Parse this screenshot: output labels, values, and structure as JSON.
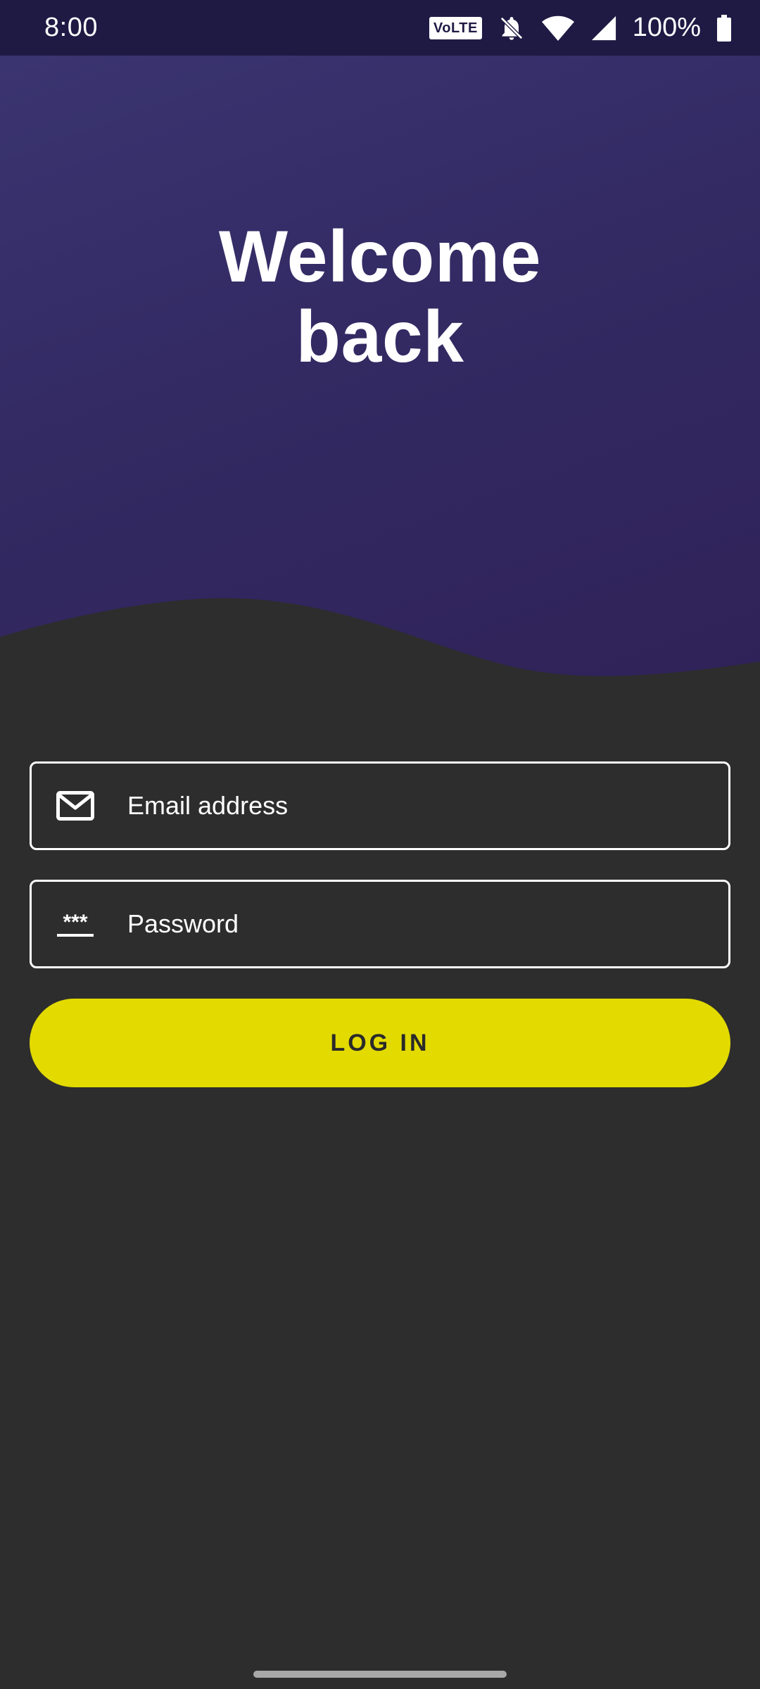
{
  "status_bar": {
    "time": "8:00",
    "network_badge": "VoLTE",
    "battery_percent": "100%",
    "icons": [
      "volte-icon",
      "bell-off-icon",
      "wifi-icon",
      "signal-icon",
      "battery-icon"
    ]
  },
  "hero": {
    "title_line1": "Welcome",
    "title_line2": "back"
  },
  "form": {
    "email_placeholder": "Email address",
    "email_icon": "mail-icon",
    "password_placeholder": "Password",
    "password_icon": "password-icon",
    "password_mask": "***",
    "login_label": "LOG IN"
  },
  "colors": {
    "hero_gradient_start": "#3a3470",
    "hero_gradient_end": "#2f2258",
    "background": "#2d2d2d",
    "accent": "#e3da00",
    "status_bar": "#1f1a44"
  }
}
